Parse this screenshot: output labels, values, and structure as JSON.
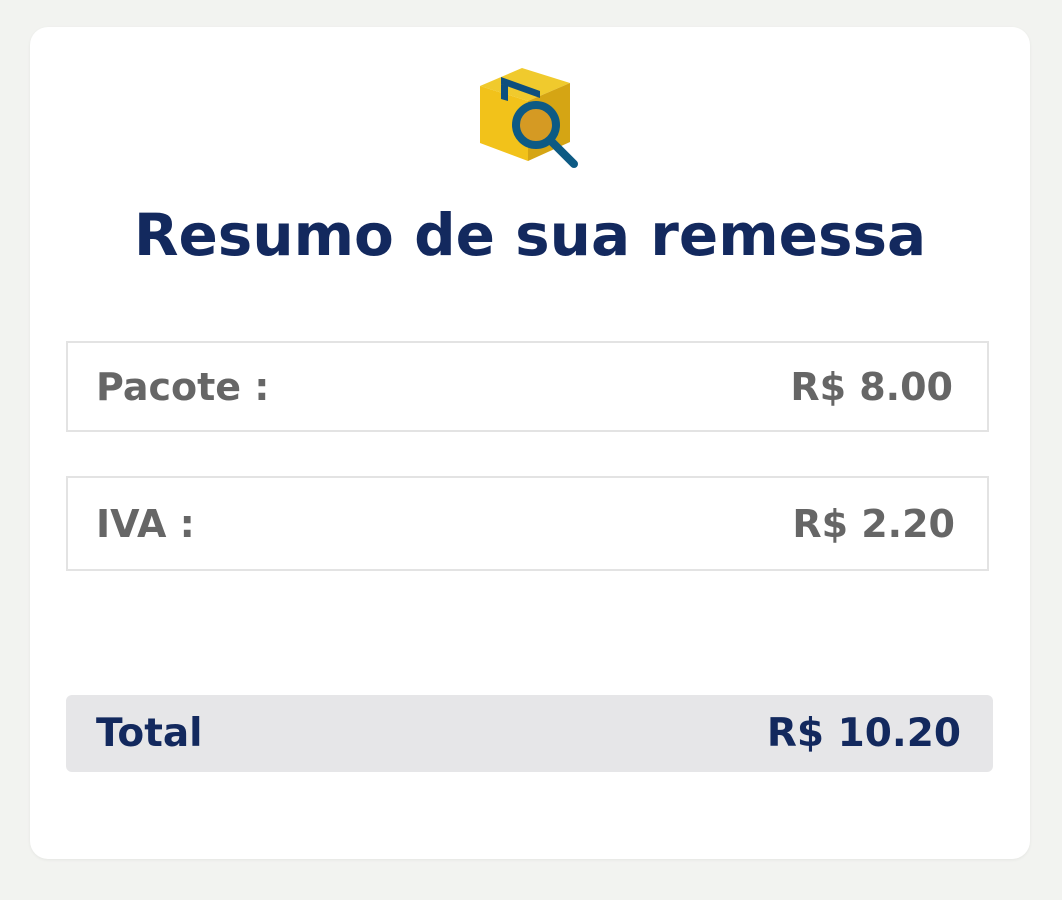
{
  "summary": {
    "title": "Resumo de sua remessa",
    "icon": "package-search-icon",
    "items": [
      {
        "label": "Pacote :",
        "value": "R$ 8.00"
      },
      {
        "label": "IVA :",
        "value": "R$ 2.20"
      }
    ],
    "total": {
      "label": "Total",
      "value": "R$ 10.20"
    }
  },
  "colors": {
    "page_background": "#f2f3f0",
    "card_background": "#ffffff",
    "title_color": "#13295e",
    "row_text_color": "#666666",
    "total_background": "#e6e6e8",
    "package_yellow": "#f2c21a",
    "package_shadow": "#d4a315",
    "magnifier_blue": "#0d5a84"
  }
}
